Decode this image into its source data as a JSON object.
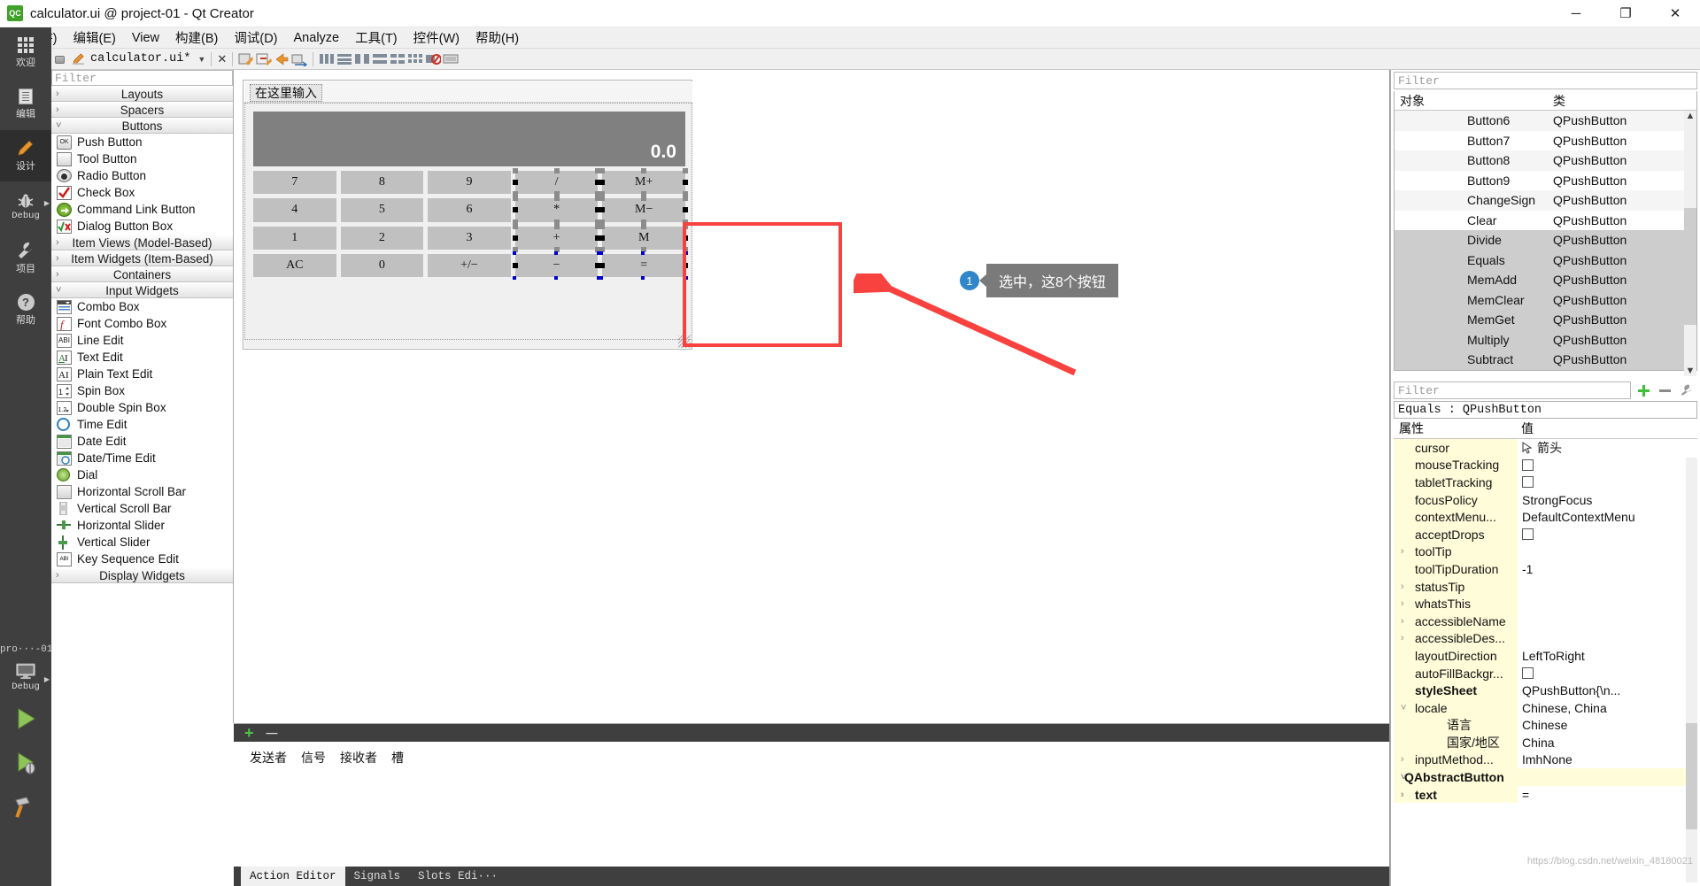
{
  "window": {
    "title": "calculator.ui @ project-01 - Qt Creator",
    "app_icon": "qt-creator-icon",
    "minimize": "─",
    "maximize": "❐",
    "close": "✕"
  },
  "menubar": {
    "items": [
      {
        "label": "文件(F)",
        "name": "menu-file"
      },
      {
        "label": "编辑(E)",
        "name": "menu-edit"
      },
      {
        "label": "View",
        "name": "menu-view"
      },
      {
        "label": "构建(B)",
        "name": "menu-build"
      },
      {
        "label": "调试(D)",
        "name": "menu-debug"
      },
      {
        "label": "Analyze",
        "name": "menu-analyze"
      },
      {
        "label": "工具(T)",
        "name": "menu-tools"
      },
      {
        "label": "控件(W)",
        "name": "menu-window"
      },
      {
        "label": "帮助(H)",
        "name": "menu-help"
      }
    ]
  },
  "toolbar": {
    "filename": "calculator.ui*",
    "dropdown_caret": "▼",
    "close_x": "✕"
  },
  "modebar": {
    "items": [
      {
        "label": "欢迎",
        "icon": "grid-icon",
        "name": "mode-welcome",
        "active": false
      },
      {
        "label": "编辑",
        "icon": "document-icon",
        "name": "mode-edit",
        "active": false
      },
      {
        "label": "设计",
        "icon": "pencil-icon",
        "name": "mode-design",
        "active": true
      },
      {
        "label": "Debug",
        "icon": "bug-icon",
        "name": "mode-debug",
        "active": false
      },
      {
        "label": "项目",
        "icon": "wrench-icon",
        "name": "mode-projects",
        "active": false
      },
      {
        "label": "帮助",
        "icon": "question-icon",
        "name": "mode-help",
        "active": false
      }
    ],
    "kit": {
      "project": "pro···-01",
      "build_config": "Debug",
      "run_label": "run-button",
      "debug_label": "start-debugging-button",
      "build_label": "build-button"
    }
  },
  "widgetbox": {
    "filter_placeholder": "Filter",
    "groups": [
      {
        "label": "Layouts",
        "expanded": false,
        "name": "widget-group-layouts",
        "items": []
      },
      {
        "label": "Spacers",
        "expanded": false,
        "name": "widget-group-spacers",
        "items": []
      },
      {
        "label": "Buttons",
        "expanded": true,
        "name": "widget-group-buttons",
        "items": [
          {
            "label": "Push Button",
            "icon": "push-button-icon"
          },
          {
            "label": "Tool Button",
            "icon": "tool-button-icon"
          },
          {
            "label": "Radio Button",
            "icon": "radio-button-icon"
          },
          {
            "label": "Check Box",
            "icon": "check-box-icon"
          },
          {
            "label": "Command Link Button",
            "icon": "command-link-button-icon"
          },
          {
            "label": "Dialog Button Box",
            "icon": "dialog-button-box-icon"
          }
        ]
      },
      {
        "label": "Item Views (Model-Based)",
        "expanded": false,
        "name": "widget-group-item-views",
        "items": []
      },
      {
        "label": "Item Widgets (Item-Based)",
        "expanded": false,
        "name": "widget-group-item-widgets",
        "items": []
      },
      {
        "label": "Containers",
        "expanded": false,
        "name": "widget-group-containers",
        "items": []
      },
      {
        "label": "Input Widgets",
        "expanded": true,
        "name": "widget-group-input-widgets",
        "items": [
          {
            "label": "Combo Box",
            "icon": "combo-box-icon"
          },
          {
            "label": "Font Combo Box",
            "icon": "font-combo-box-icon"
          },
          {
            "label": "Line Edit",
            "icon": "line-edit-icon"
          },
          {
            "label": "Text Edit",
            "icon": "text-edit-icon"
          },
          {
            "label": "Plain Text Edit",
            "icon": "plain-text-edit-icon"
          },
          {
            "label": "Spin Box",
            "icon": "spin-box-icon"
          },
          {
            "label": "Double Spin Box",
            "icon": "double-spin-box-icon"
          },
          {
            "label": "Time Edit",
            "icon": "time-edit-icon"
          },
          {
            "label": "Date Edit",
            "icon": "date-edit-icon"
          },
          {
            "label": "Date/Time Edit",
            "icon": "date-time-edit-icon"
          },
          {
            "label": "Dial",
            "icon": "dial-icon"
          },
          {
            "label": "Horizontal Scroll Bar",
            "icon": "horizontal-scroll-bar-icon"
          },
          {
            "label": "Vertical Scroll Bar",
            "icon": "vertical-scroll-bar-icon"
          },
          {
            "label": "Horizontal Slider",
            "icon": "horizontal-slider-icon"
          },
          {
            "label": "Vertical Slider",
            "icon": "vertical-slider-icon"
          },
          {
            "label": "Key Sequence Edit",
            "icon": "key-sequence-edit-icon"
          }
        ]
      },
      {
        "label": "Display Widgets",
        "expanded": false,
        "name": "widget-group-display-widgets",
        "items": []
      }
    ]
  },
  "form": {
    "menu_placeholder": "在这里输入",
    "display_value": "0.0",
    "keys": [
      {
        "text": "7",
        "selected": false
      },
      {
        "text": "8",
        "selected": false
      },
      {
        "text": "9",
        "selected": false
      },
      {
        "text": "/",
        "selected": true
      },
      {
        "text": "M+",
        "selected": true
      },
      {
        "text": "4",
        "selected": false
      },
      {
        "text": "5",
        "selected": false
      },
      {
        "text": "6",
        "selected": false
      },
      {
        "text": "*",
        "selected": true
      },
      {
        "text": "M−",
        "selected": true
      },
      {
        "text": "1",
        "selected": false
      },
      {
        "text": "2",
        "selected": false
      },
      {
        "text": "3",
        "selected": false
      },
      {
        "text": "+",
        "selected": true
      },
      {
        "text": "M",
        "selected": true
      },
      {
        "text": "AC",
        "selected": false
      },
      {
        "text": "0",
        "selected": false
      },
      {
        "text": "+/−",
        "selected": false
      },
      {
        "text": "−",
        "selected": true
      },
      {
        "text": "=",
        "selected": true
      }
    ]
  },
  "annotation": {
    "badge": "1",
    "text": "选中，这8个按钮",
    "box_color": "#f8423f",
    "bubble_color": "#7a7a7a",
    "badge_color": "#2f86c9",
    "arrow_color": "#f8423f"
  },
  "signal_slot_editor": {
    "add_label": "+",
    "remove_label": "─",
    "columns": [
      "发送者",
      "信号",
      "接收者",
      "槽"
    ],
    "tabs": [
      {
        "label": "Action Editor",
        "active": true
      },
      {
        "label": "Signals",
        "active": false
      },
      {
        "label": "Slots Edi···",
        "active": false
      }
    ]
  },
  "object_inspector": {
    "filter_placeholder": "Filter",
    "columns": [
      "对象",
      "类"
    ],
    "rows": [
      {
        "object": "Button6",
        "class": "QPushButton",
        "selected": false
      },
      {
        "object": "Button7",
        "class": "QPushButton",
        "selected": false
      },
      {
        "object": "Button8",
        "class": "QPushButton",
        "selected": false
      },
      {
        "object": "Button9",
        "class": "QPushButton",
        "selected": false
      },
      {
        "object": "ChangeSign",
        "class": "QPushButton",
        "selected": false
      },
      {
        "object": "Clear",
        "class": "QPushButton",
        "selected": false
      },
      {
        "object": "Divide",
        "class": "QPushButton",
        "selected": true
      },
      {
        "object": "Equals",
        "class": "QPushButton",
        "selected": true
      },
      {
        "object": "MemAdd",
        "class": "QPushButton",
        "selected": true
      },
      {
        "object": "MemClear",
        "class": "QPushButton",
        "selected": true
      },
      {
        "object": "MemGet",
        "class": "QPushButton",
        "selected": true
      },
      {
        "object": "Multiply",
        "class": "QPushButton",
        "selected": true
      },
      {
        "object": "Subtract",
        "class": "QPushButton",
        "selected": true
      }
    ]
  },
  "property_editor": {
    "filter_placeholder": "Filter",
    "object_header": "Equals : QPushButton",
    "columns": [
      "属性",
      "值"
    ],
    "add_icon": "plus-icon",
    "remove_icon": "minus-icon",
    "config_icon": "wrench-icon",
    "rows": [
      {
        "name": "cursor",
        "value": "箭头",
        "type": "cursor",
        "twisty": false,
        "indent": 1,
        "bold": false
      },
      {
        "name": "mouseTracking",
        "value": "",
        "type": "checkbox",
        "twisty": false,
        "indent": 1,
        "bold": false
      },
      {
        "name": "tabletTracking",
        "value": "",
        "type": "checkbox",
        "twisty": false,
        "indent": 1,
        "bold": false
      },
      {
        "name": "focusPolicy",
        "value": "StrongFocus",
        "type": "text",
        "twisty": false,
        "indent": 1,
        "bold": false
      },
      {
        "name": "contextMenu...",
        "value": "DefaultContextMenu",
        "type": "text",
        "twisty": false,
        "indent": 1,
        "bold": false
      },
      {
        "name": "acceptDrops",
        "value": "",
        "type": "checkbox",
        "twisty": false,
        "indent": 1,
        "bold": false
      },
      {
        "name": "toolTip",
        "value": "",
        "type": "text",
        "twisty": true,
        "indent": 1,
        "bold": false
      },
      {
        "name": "toolTipDuration",
        "value": "-1",
        "type": "text",
        "twisty": false,
        "indent": 1,
        "bold": false
      },
      {
        "name": "statusTip",
        "value": "",
        "type": "text",
        "twisty": true,
        "indent": 1,
        "bold": false
      },
      {
        "name": "whatsThis",
        "value": "",
        "type": "text",
        "twisty": true,
        "indent": 1,
        "bold": false
      },
      {
        "name": "accessibleName",
        "value": "",
        "type": "text",
        "twisty": true,
        "indent": 1,
        "bold": false
      },
      {
        "name": "accessibleDes...",
        "value": "",
        "type": "text",
        "twisty": true,
        "indent": 1,
        "bold": false
      },
      {
        "name": "layoutDirection",
        "value": "LeftToRight",
        "type": "text",
        "twisty": false,
        "indent": 1,
        "bold": false
      },
      {
        "name": "autoFillBackgr...",
        "value": "",
        "type": "checkbox",
        "twisty": false,
        "indent": 1,
        "bold": false
      },
      {
        "name": "styleSheet",
        "value": "QPushButton{\\n...",
        "type": "text",
        "twisty": false,
        "indent": 1,
        "bold": true
      },
      {
        "name": "locale",
        "value": "Chinese, China",
        "type": "text",
        "twisty": "open",
        "indent": 0,
        "bold": false
      },
      {
        "name": "语言",
        "value": "Chinese",
        "type": "text",
        "twisty": false,
        "indent": 2,
        "bold": false
      },
      {
        "name": "国家/地区",
        "value": "China",
        "type": "text",
        "twisty": false,
        "indent": 2,
        "bold": false
      },
      {
        "name": "inputMethod...",
        "value": "ImhNone",
        "type": "text",
        "twisty": true,
        "indent": 1,
        "bold": false
      },
      {
        "name": "QAbstractButton",
        "value": "",
        "type": "group",
        "twisty": "open",
        "indent": 0,
        "bold": true
      },
      {
        "name": "text",
        "value": "=",
        "type": "text",
        "twisty": true,
        "indent": 1,
        "bold": true
      }
    ]
  },
  "watermark": "https://blog.csdn.net/weixin_48180021"
}
